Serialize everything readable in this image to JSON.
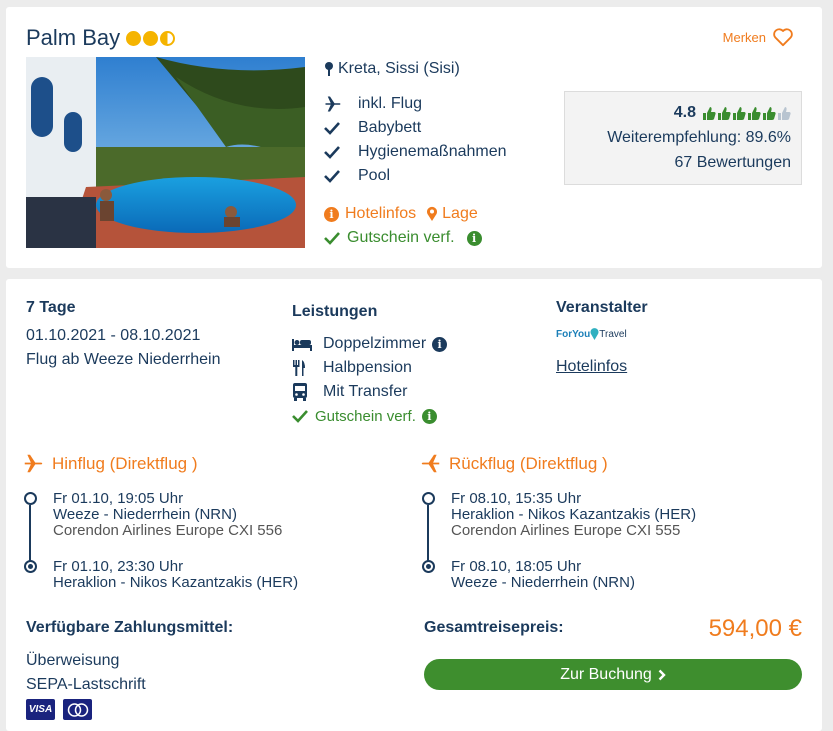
{
  "hotel": {
    "name": "Palm Bay",
    "sun_rating": 2.5,
    "merken_label": "Merken",
    "location": "Kreta, Sissi (Sisi)",
    "features": [
      "inkl. Flug",
      "Babybett",
      "Hygienemaßnahmen",
      "Pool"
    ],
    "hotelinfos_label": "Hotelinfos",
    "lage_label": "Lage",
    "voucher_label": "Gutschein verf."
  },
  "rating": {
    "score": "4.8",
    "thumbs_filled": 5,
    "thumbs_total": 6,
    "recommendation": "Weiterempfehlung: 89.6%",
    "reviews": "67 Bewertungen"
  },
  "offer": {
    "duration": "7 Tage",
    "dates": "01.10.2021 - 08.10.2021",
    "departure": "Flug ab Weeze Niederrhein",
    "services_title": "Leistungen",
    "services": [
      "Doppelzimmer",
      "Halbpension",
      "Mit Transfer"
    ],
    "voucher_label": "Gutschein verf.",
    "operator_title": "Veranstalter",
    "operator_brand": "ForYou",
    "operator_brand_2": "Travel",
    "operator_link": "Hotelinfos"
  },
  "outbound": {
    "title": "Hinflug (Direktflug )",
    "dep_time": "Fr 01.10, 19:05 Uhr",
    "dep_airport": "Weeze - Niederrhein (NRN)",
    "airline": "Corendon Airlines Europe CXI 556",
    "arr_time": "Fr 01.10, 23:30 Uhr",
    "arr_airport": "Heraklion - Nikos Kazantzakis (HER)"
  },
  "return": {
    "title": "Rückflug (Direktflug )",
    "dep_time": "Fr 08.10, 15:35 Uhr",
    "dep_airport": "Heraklion - Nikos Kazantzakis (HER)",
    "airline": "Corendon Airlines Europe CXI 555",
    "arr_time": "Fr 08.10, 18:05 Uhr",
    "arr_airport": "Weeze - Niederrhein (NRN)"
  },
  "payment": {
    "title": "Verfügbare Zahlungsmittel:",
    "methods": [
      "Überweisung",
      "SEPA-Lastschrift"
    ],
    "logos": [
      "VISA",
      "Mastercard"
    ]
  },
  "total": {
    "label": "Gesamtreisepreis:",
    "price": "594,00 €",
    "book_label": "Zur Buchung"
  },
  "colors": {
    "accent": "#f07c1e",
    "green": "#3a8d2f",
    "navy": "#1b3a5c"
  }
}
